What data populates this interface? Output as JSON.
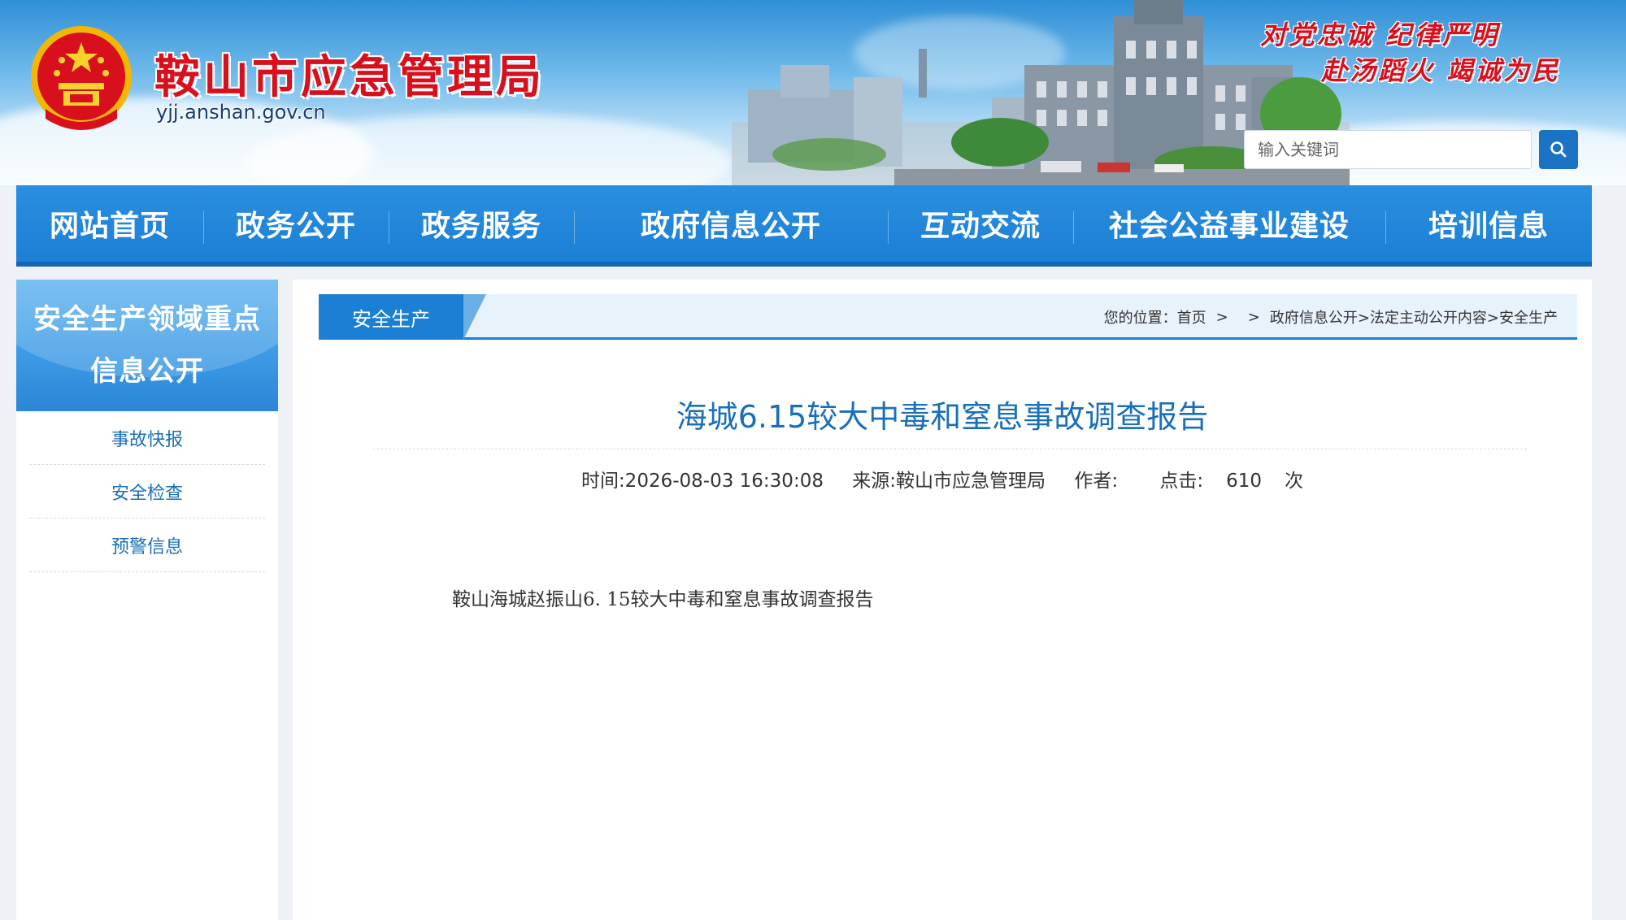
{
  "header": {
    "site_title": "鞍山市应急管理局",
    "domain": "yjj.anshan.gov.cn",
    "slogan_line1": "对党忠诚 纪律严明",
    "slogan_line2": "赴汤蹈火 竭诚为民",
    "search_placeholder": "输入关键词",
    "search_button_icon": "search-icon",
    "colors": {
      "title_red": "#d8101d",
      "brand_blue": "#1b7fd4"
    }
  },
  "nav": {
    "items": [
      {
        "label": "网站首页"
      },
      {
        "label": "政务公开"
      },
      {
        "label": "政务服务"
      },
      {
        "label": "政府信息公开"
      },
      {
        "label": "互动交流"
      },
      {
        "label": "社会公益事业建设"
      },
      {
        "label": "培训信息"
      }
    ]
  },
  "sidebar": {
    "title": "安全生产领域重点信息公开",
    "items": [
      {
        "label": "事故快报"
      },
      {
        "label": "安全检查"
      },
      {
        "label": "预警信息"
      }
    ]
  },
  "main": {
    "category_tab": "安全生产",
    "breadcrumb": {
      "prefix": "您的位置：",
      "home": "首页",
      "sep": ">",
      "path": "政府信息公开>法定主动公开内容>安全生产"
    },
    "article": {
      "title": "海城6.15较大中毒和窒息事故调查报告",
      "time": "时间:2026-08-03 16:30:08",
      "source": "来源:鞍山市应急管理局",
      "author": "作者:",
      "clicks_label": "点击:",
      "clicks": "610",
      "clicks_unit": "次",
      "body": "鞍山海城赵振山6. 15较大中毒和窒息事故调查报告"
    }
  }
}
